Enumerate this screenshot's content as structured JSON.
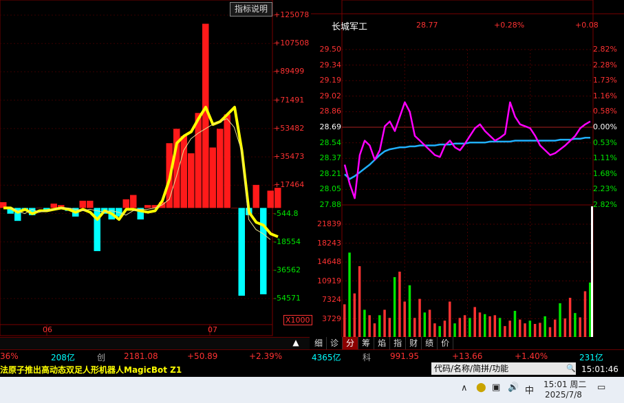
{
  "left_chart": {
    "indicator_button": "指标说明",
    "axis_labels": [
      "+125078",
      "+107508",
      "+89499",
      "+71491",
      "+53482",
      "+35473",
      "+17464",
      "-544.8",
      "-18554",
      "-36562",
      "-54571"
    ],
    "axis_colors": [
      "#ff3232",
      "#ff3232",
      "#ff3232",
      "#ff3232",
      "#ff3232",
      "#ff3232",
      "#ff3232",
      "#00e600",
      "#00e600",
      "#00e600",
      "#00e600"
    ],
    "unit_label": "X1000",
    "x_labels": [
      "06",
      "07"
    ]
  },
  "chart_data": [
    {
      "type": "bar",
      "title": "",
      "yunit": "X1000",
      "ylim": [
        -63000,
        134000
      ],
      "categories": [
        "06",
        "07"
      ],
      "series": [
        {
          "values": [
            4000,
            -4000,
            -9000,
            -2000,
            -5000,
            0,
            -1000,
            3000,
            2000,
            -2000,
            -6000,
            5000,
            5000,
            -30000,
            -4000,
            -8000,
            -6000,
            6000,
            9000,
            -8000,
            2000,
            2000,
            4000,
            45000,
            55000,
            50000,
            38000,
            66000,
            128000,
            42000,
            55000,
            65000,
            0,
            -61000,
            -5000,
            16000,
            -60000,
            12000,
            14000
          ]
        },
        {
          "values": [
            0,
            -2000,
            -4000,
            -1000,
            -3000,
            -2000,
            -1000,
            0,
            0,
            -1000,
            -2000,
            -1000,
            -2000,
            -3000,
            -2000,
            -3000,
            -5000,
            -2000,
            -1000,
            -1000,
            0,
            2000,
            6000,
            22000,
            40000,
            48000,
            52000,
            55000,
            58000,
            60000,
            62000,
            56000,
            40000,
            -8000,
            -15000,
            -18000,
            -22000
          ]
        }
      ]
    },
    {
      "type": "line",
      "title": "",
      "ylim": [
        27.88,
        29.5
      ],
      "yticks": [
        29.5,
        29.34,
        29.19,
        29.02,
        28.86,
        28.69,
        28.54,
        28.37,
        28.21,
        28.05,
        27.88
      ],
      "series": [
        {
          "values": [
            28.3,
            28.1,
            27.95,
            28.4,
            28.55,
            28.5,
            28.35,
            28.45,
            28.7,
            28.75,
            28.65,
            28.8,
            28.95,
            28.85,
            28.6,
            28.55,
            28.5,
            28.45,
            28.4,
            28.38,
            28.5,
            28.55,
            28.48,
            28.45,
            28.52,
            28.6,
            28.68,
            28.72,
            28.65,
            28.6,
            28.55,
            28.58,
            28.62,
            28.95,
            28.8,
            28.72,
            28.7,
            28.68,
            28.6,
            28.5,
            28.45,
            28.4,
            28.42,
            28.46,
            28.5,
            28.55,
            28.6,
            28.68,
            28.72,
            28.75
          ]
        },
        {
          "values": [
            28.2,
            28.15,
            28.18,
            28.22,
            28.26,
            28.3,
            28.35,
            28.4,
            28.44,
            28.46,
            28.47,
            28.48,
            28.48,
            28.49,
            28.49,
            28.5,
            28.5,
            28.5,
            28.5,
            28.51,
            28.51,
            28.51,
            28.52,
            28.52,
            28.52,
            28.53,
            28.53,
            28.53,
            28.53,
            28.54,
            28.54,
            28.54,
            28.54,
            28.54,
            28.55,
            28.55,
            28.55,
            28.55,
            28.55,
            28.55,
            28.55,
            28.55,
            28.55,
            28.56,
            28.56,
            28.56,
            28.57,
            28.57,
            28.58,
            28.58
          ]
        }
      ]
    },
    {
      "type": "bar",
      "title": "",
      "yticks": [
        21839,
        18243,
        14648,
        10919,
        7324,
        3729
      ],
      "values": [
        6000,
        15500,
        8000,
        13000,
        5000,
        4000,
        2500,
        4000,
        5000,
        3500,
        11000,
        12000,
        6500,
        9500,
        3500,
        7000,
        4500,
        5000,
        2500,
        2000,
        3000,
        6500,
        2500,
        3500,
        4000,
        3500,
        5500,
        4500,
        4200,
        3800,
        4000,
        3500,
        2000,
        3000,
        4800,
        3200,
        2500,
        3000,
        2400,
        2600,
        3800,
        1800,
        3200,
        6200,
        3400,
        7200,
        4400,
        3600,
        8400,
        10000
      ]
    }
  ],
  "right_chart": {
    "stock_name": "长城军工",
    "price": "28.77",
    "pct": "+0.28%",
    "change": "+0.08",
    "price_ticks": [
      "29.50",
      "29.34",
      "29.19",
      "29.02",
      "28.86",
      "28.69",
      "28.54",
      "28.37",
      "28.21",
      "28.05",
      "27.88"
    ],
    "pct_ticks": [
      "2.82%",
      "2.28%",
      "1.73%",
      "1.16%",
      "0.58%",
      "0.00%",
      "0.53%",
      "1.11%",
      "1.68%",
      "2.23%",
      "2.82%"
    ],
    "volume_ticks": [
      "21839",
      "18243",
      "14648",
      "10919",
      "7324",
      "3729"
    ],
    "tabs": [
      "细",
      "诊",
      "分",
      "筹",
      "焰",
      "指",
      "财",
      "绩",
      "价"
    ],
    "active_tab": 2
  },
  "ticker": {
    "a": "36%",
    "b": "208亿",
    "c": "创",
    "d": "2181.08",
    "e": "+50.89",
    "f": "+2.39%",
    "g": "4365亿",
    "h": "科",
    "i": "991.95",
    "j": "+13.66",
    "k": "+1.40%",
    "l": "231亿"
  },
  "news": "法原子推出高动态双足人形机器人MagicBot Z1",
  "search_placeholder": "代码/名称/简拼/功能",
  "clock": "15:01:46",
  "taskbar": {
    "ime": "中",
    "time": "15:01 周二",
    "date": "2025/7/8"
  },
  "colors": {
    "up": "#ff3232",
    "down": "#00e600",
    "cyan": "#00ffff",
    "yellow": "#ffff00",
    "magenta": "#ff00ff"
  }
}
